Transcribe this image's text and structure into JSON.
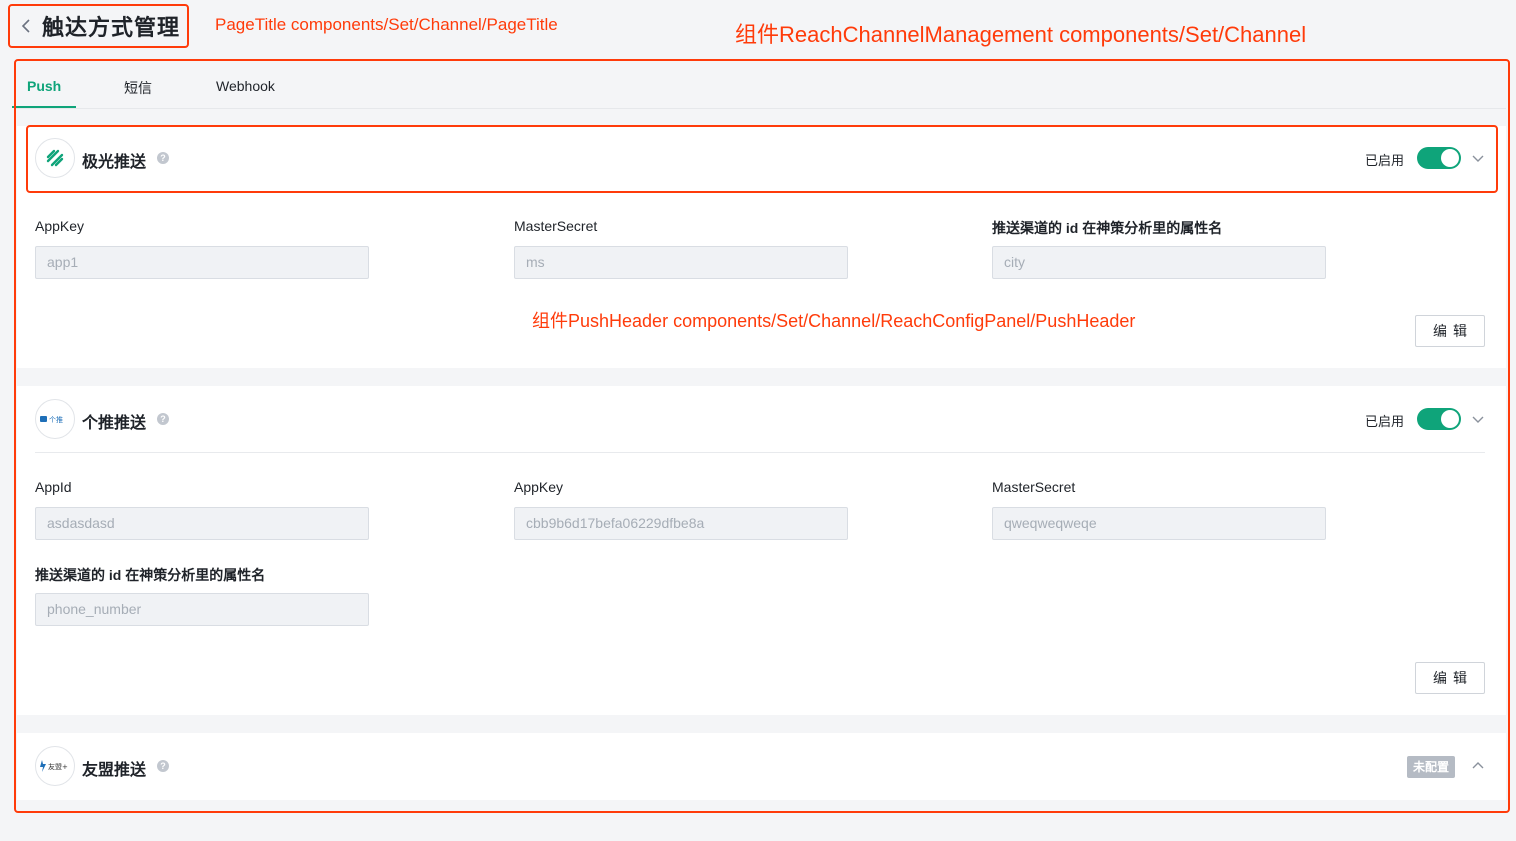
{
  "page": {
    "title": "触达方式管理"
  },
  "annotations": {
    "page_title": "PageTitle components/Set/Channel/PageTitle",
    "channel_component": "组件ReachChannelManagement  components/Set/Channel",
    "push_header": "组件PushHeader  components/Set/Channel/ReachConfigPanel/PushHeader"
  },
  "tabs": [
    {
      "label": "Push",
      "active": true
    },
    {
      "label": "短信",
      "active": false
    },
    {
      "label": "Webhook",
      "active": false
    }
  ],
  "panels": {
    "jpush": {
      "name": "极光推送",
      "status": "已启用",
      "enabled": true,
      "icon": "jpush-logo-icon",
      "fields": [
        {
          "label": "AppKey",
          "value": "app1"
        },
        {
          "label": "MasterSecret",
          "value": "ms"
        },
        {
          "label": "推送渠道的 id 在神策分析里的属性名",
          "value": "city"
        }
      ],
      "edit_label": "编辑"
    },
    "getui": {
      "name": "个推推送",
      "status": "已启用",
      "enabled": true,
      "icon": "getui-logo-icon",
      "logo_text": "个推",
      "fields": [
        {
          "label": "AppId",
          "value": "asdasdasd"
        },
        {
          "label": "AppKey",
          "value": "cbb9b6d17befa06229dfbe8a"
        },
        {
          "label": "MasterSecret",
          "value": "qweqweqweqe"
        },
        {
          "label": "推送渠道的 id 在神策分析里的属性名",
          "value": "phone_number"
        }
      ],
      "edit_label": "编辑"
    },
    "umeng": {
      "name": "友盟推送",
      "status": "未配置",
      "enabled": false,
      "icon": "umeng-logo-icon",
      "logo_text": "友盟+"
    }
  },
  "colors": {
    "accent": "#0fa47a",
    "annotation": "#ff3b0a",
    "background": "#f4f5f7"
  }
}
